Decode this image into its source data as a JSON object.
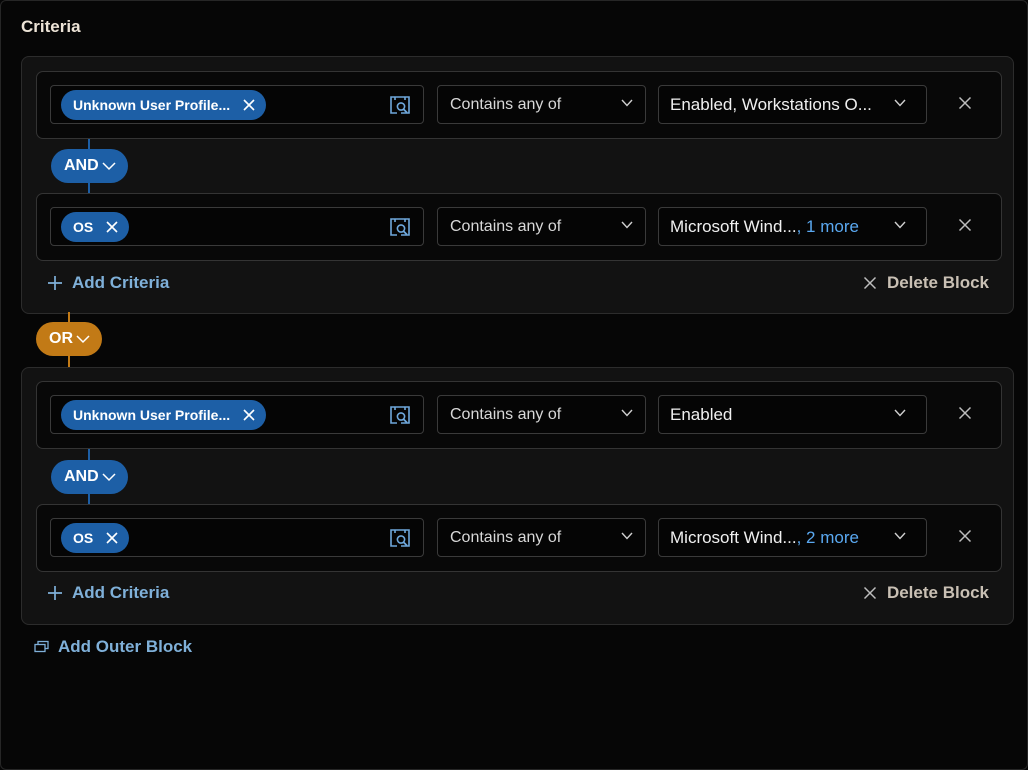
{
  "header": {
    "title": "Criteria"
  },
  "blocks": [
    {
      "rows": [
        {
          "field": "Unknown User Profile...",
          "operator": "Contains any of",
          "value": "Enabled, Workstations O...",
          "more": ""
        },
        {
          "field": "OS",
          "operator": "Contains any of",
          "value": "Microsoft Wind...",
          "more": ", 1 more"
        }
      ],
      "inner_operator": "AND",
      "add_criteria_label": "Add Criteria",
      "delete_block_label": "Delete Block"
    },
    {
      "rows": [
        {
          "field": "Unknown User Profile...",
          "operator": "Contains any of",
          "value": "Enabled",
          "more": ""
        },
        {
          "field": "OS",
          "operator": "Contains any of",
          "value": "Microsoft Wind...",
          "more": ", 2 more"
        }
      ],
      "inner_operator": "AND",
      "add_criteria_label": "Add Criteria",
      "delete_block_label": "Delete Block"
    }
  ],
  "outer_operator": "OR",
  "footer": {
    "add_outer_block_label": "Add Outer Block"
  },
  "colors": {
    "and_pill": "#1d5fa6",
    "or_pill": "#c27a16",
    "link": "#7fb0d9",
    "more": "#5aa8f0"
  },
  "icons": [
    "close-icon",
    "lookup-icon",
    "chevron-down-icon",
    "plus-icon",
    "add-outer-block-icon"
  ]
}
